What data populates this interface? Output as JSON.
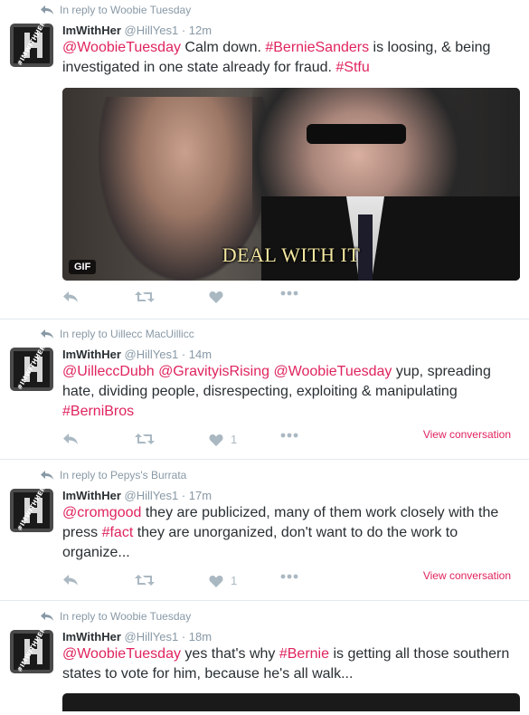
{
  "colors": {
    "link": "#e0245e",
    "muted": "#8899a6",
    "icon": "#aab8c2"
  },
  "tweets": [
    {
      "reply_to": "In reply to Woobie Tuesday",
      "name": "ImWithHer",
      "handle": "@HillYes1",
      "dot": "·",
      "time": "12m",
      "parts": [
        {
          "t": "@WoobieTuesday",
          "link": true
        },
        {
          "t": " Calm down. "
        },
        {
          "t": "#BernieSanders",
          "link": true
        },
        {
          "t": " is loosing, & being investigated in one state already for fraud. "
        },
        {
          "t": "#Stfu",
          "link": true
        }
      ],
      "media": {
        "caption": "DEAL WITH IT",
        "badge": "GIF"
      },
      "like_count": "",
      "view_conversation": ""
    },
    {
      "reply_to": "In reply to Uillecc MacUillicc",
      "name": "ImWithHer",
      "handle": "@HillYes1",
      "dot": "·",
      "time": "14m",
      "parts": [
        {
          "t": "@UilleccDubh",
          "link": true
        },
        {
          "t": " "
        },
        {
          "t": "@GravityisRising",
          "link": true
        },
        {
          "t": " "
        },
        {
          "t": "@WoobieTuesday",
          "link": true
        },
        {
          "t": " yup, spreading hate, dividing people, disrespecting, exploiting & manipulating "
        },
        {
          "t": "#BerniBros",
          "link": true
        }
      ],
      "like_count": "1",
      "view_conversation": "View conversation"
    },
    {
      "reply_to": "In reply to Pepys's Burrata",
      "name": "ImWithHer",
      "handle": "@HillYes1",
      "dot": "·",
      "time": "17m",
      "parts": [
        {
          "t": "@cromgood",
          "link": true
        },
        {
          "t": " they are publicized, many of them work closely with the press "
        },
        {
          "t": "#fact",
          "link": true
        },
        {
          "t": " they are unorganized, don't want to do the work to organize..."
        }
      ],
      "like_count": "1",
      "view_conversation": "View conversation"
    },
    {
      "reply_to": "In reply to Woobie Tuesday",
      "name": "ImWithHer",
      "handle": "@HillYes1",
      "dot": "·",
      "time": "18m",
      "parts": [
        {
          "t": "@WoobieTuesday",
          "link": true
        },
        {
          "t": " yes that's why "
        },
        {
          "t": "#Bernie",
          "link": true
        },
        {
          "t": " is getting all those southern states to vote for him, because he's all walk..."
        }
      ],
      "like_count": "",
      "view_conversation": ""
    }
  ],
  "avatar_tag": "#IMWITHHER",
  "icons": [
    "reply-icon",
    "retweet-icon",
    "like-icon",
    "more-icon",
    "reply-context-arrow-icon"
  ]
}
